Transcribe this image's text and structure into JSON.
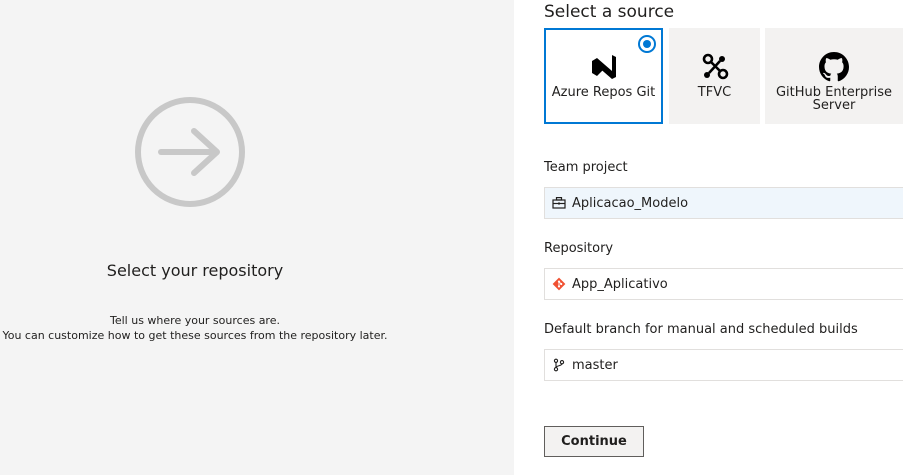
{
  "intro": {
    "title": "Select your repository",
    "line1": "Tell us where your sources are.",
    "line2": "You can customize how to get these sources from the repository later."
  },
  "source": {
    "heading": "Select a source",
    "options": [
      {
        "label": "Azure Repos Git",
        "icon": "azure-repos-icon",
        "selected": true
      },
      {
        "label": "TFVC",
        "icon": "tfvc-icon",
        "selected": false
      },
      {
        "label_line1": "GitHub Enterprise",
        "label_line2": "Server",
        "icon": "github-icon",
        "selected": false
      }
    ]
  },
  "team_project": {
    "label": "Team project",
    "value": "Aplicacao_Modelo",
    "icon": "briefcase-icon"
  },
  "repository": {
    "label": "Repository",
    "value": "App_Aplicativo",
    "icon": "git-icon"
  },
  "branch": {
    "label": "Default branch for manual and scheduled builds",
    "value": "master",
    "icon": "branch-icon"
  },
  "actions": {
    "continue_label": "Continue"
  },
  "colors": {
    "accent": "#0078d4",
    "git_orange": "#f05133",
    "panel_bg": "#f4f4f4",
    "tile_bg": "#f3f2f1"
  }
}
